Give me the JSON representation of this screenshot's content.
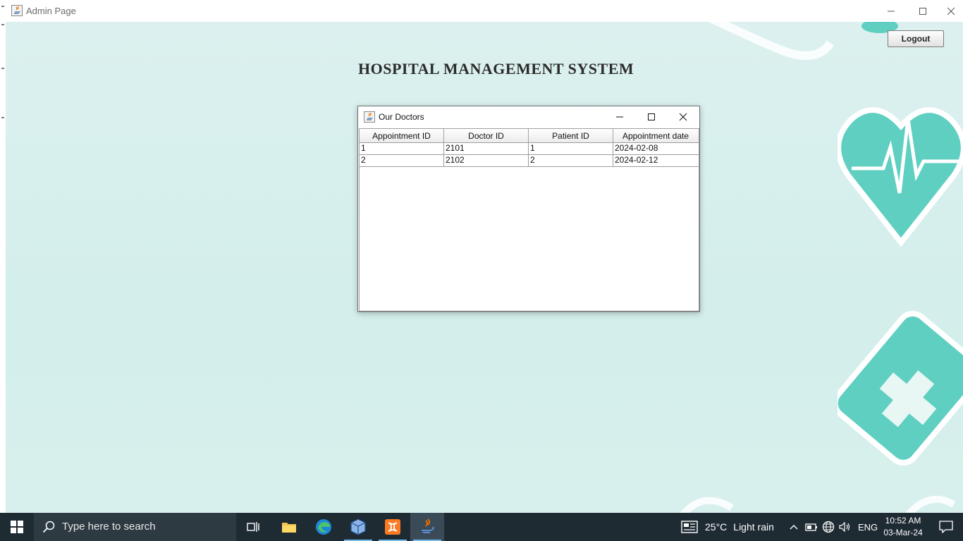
{
  "window": {
    "title": "Admin Page",
    "app_title": "HOSPITAL MANAGEMENT SYSTEM",
    "logout_label": "Logout"
  },
  "dialog": {
    "title": "Our Doctors",
    "columns": [
      "Appointment ID",
      "Doctor ID",
      "Patient ID",
      "Appointment date"
    ],
    "rows": [
      [
        "1",
        "2101",
        "1",
        "2024-02-08"
      ],
      [
        "2",
        "2102",
        "2",
        "2024-02-12"
      ]
    ]
  },
  "taskbar": {
    "search_placeholder": "Type here to search",
    "weather_temp": "25°C",
    "weather_desc": "Light rain",
    "language": "ENG",
    "time": "10:52 AM",
    "date": "03-Mar-24"
  },
  "colors": {
    "background": "#d6efec",
    "accent_teal": "#5fcfc2",
    "taskbar": "#1f2b33"
  }
}
